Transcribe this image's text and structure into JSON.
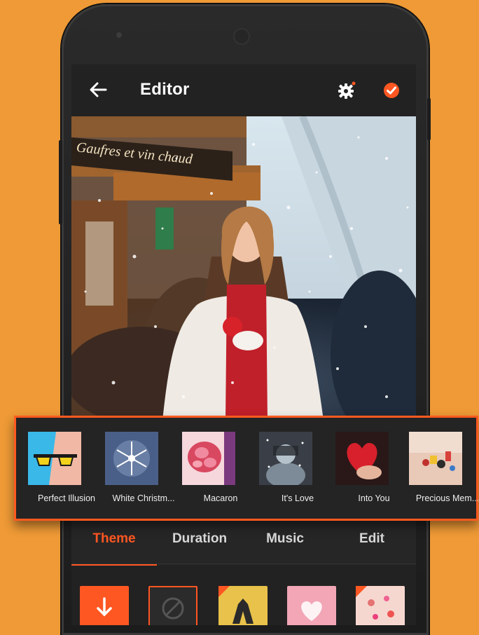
{
  "app": {
    "title": "Editor"
  },
  "appbar": {
    "back_icon": "arrow-left-icon",
    "settings_icon": "gear-icon",
    "confirm_icon": "check-circle-icon"
  },
  "preview": {
    "sign_text": "Gaufres et vin chaud"
  },
  "themes": [
    {
      "label": "Perfect Illusion",
      "icon": "sunglasses-thumb"
    },
    {
      "label": "White Christm...",
      "icon": "snowflake-thumb"
    },
    {
      "label": "Macaron",
      "icon": "macaron-thumb"
    },
    {
      "label": "It's Love",
      "icon": "love-thumb"
    },
    {
      "label": "Into You",
      "icon": "heart-thumb"
    },
    {
      "label": "Precious Mem...",
      "icon": "toys-thumb"
    }
  ],
  "tabs": [
    {
      "label": "Theme",
      "active": true
    },
    {
      "label": "Duration",
      "active": false
    },
    {
      "label": "Music",
      "active": false
    },
    {
      "label": "Edit",
      "active": false
    }
  ],
  "colors": {
    "background": "#ef9a36",
    "accent": "#ff5722"
  }
}
